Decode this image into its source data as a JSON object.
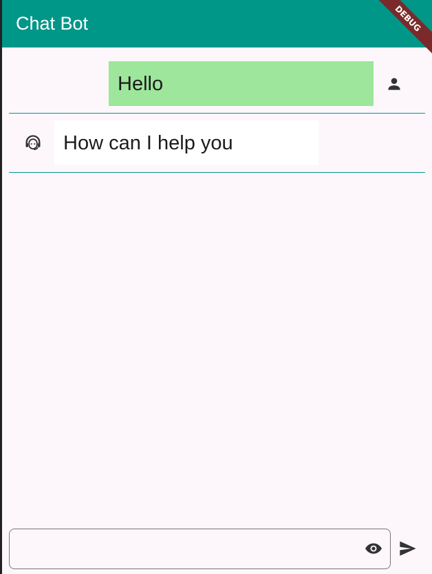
{
  "app": {
    "title": "Chat Bot",
    "debug_label": "DEBUG",
    "accent_color": "#009688",
    "user_bubble_color": "#9de69b"
  },
  "messages": [
    {
      "sender": "user",
      "text": "Hello",
      "icon": "person-icon"
    },
    {
      "sender": "bot",
      "text": "How can I help you",
      "icon": "support-agent-icon"
    }
  ],
  "composer": {
    "value": "",
    "placeholder": "",
    "visibility_icon": "eye-icon",
    "send_icon": "send-icon"
  }
}
